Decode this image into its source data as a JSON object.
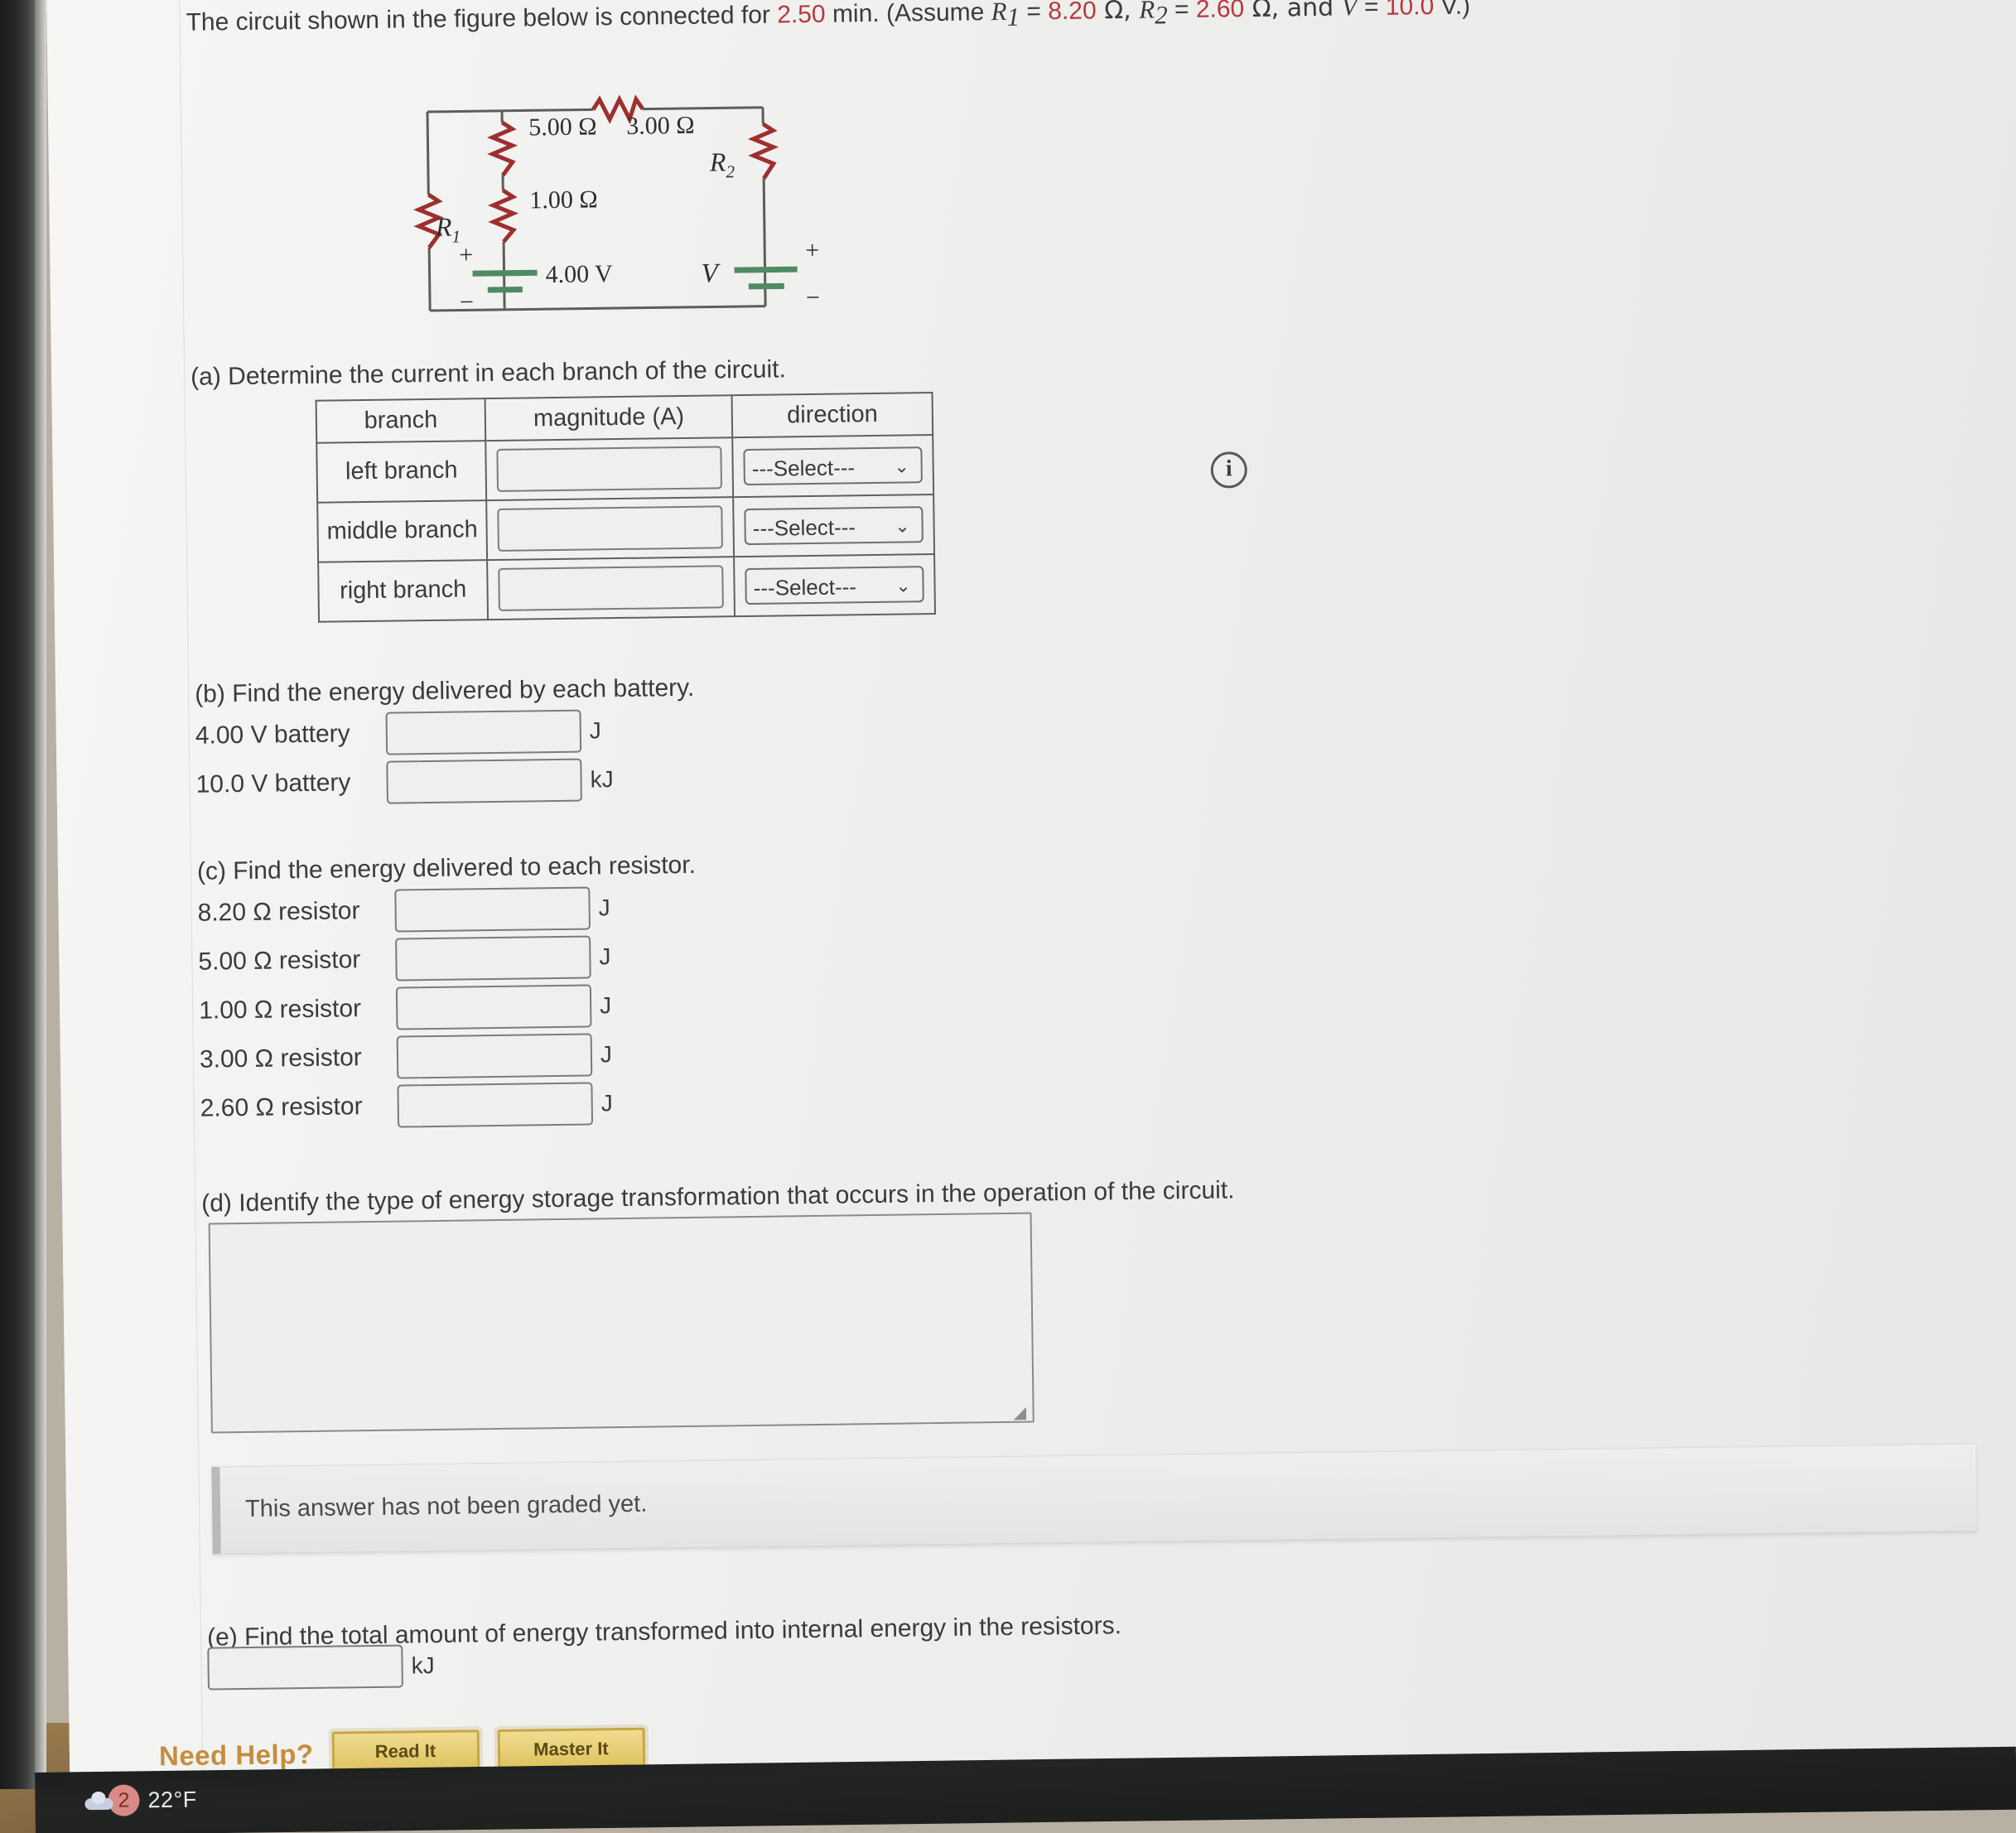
{
  "question": {
    "intro_1": "The circuit shown in the figure below is connected for ",
    "time_value": "2.50",
    "intro_2": " min. (Assume ",
    "r1_symbol": "R",
    "r1_sub": "1",
    "r1_eq": " = ",
    "r1_value": "8.20",
    "r1_unit": " Ω, ",
    "r2_symbol": "R",
    "r2_sub": "2",
    "r2_eq": " = ",
    "r2_value": "2.60",
    "r2_unit": " Ω, and ",
    "v_symbol": "V",
    "v_eq": " = ",
    "v_value": "10.0",
    "v_unit": " V.)"
  },
  "figure": {
    "r_5": "5.00 Ω",
    "r_3": "3.00 Ω",
    "r_1": "1.00 Ω",
    "battery_4v": "4.00 V",
    "label_R1": "R",
    "label_R1_sub": "1",
    "label_R2": "R",
    "label_R2_sub": "2",
    "label_V": "V",
    "plus": "+",
    "minus": "−",
    "info_icon": "i",
    "colors": {
      "resistor": "#9e2f2f",
      "wire": "#5a5e5c",
      "battery": "#4e8a63"
    }
  },
  "parts": {
    "a": {
      "prompt": "(a) Determine the current in each branch of the circuit.",
      "headers": [
        "branch",
        "magnitude (A)",
        "direction"
      ],
      "rows": [
        {
          "branch": "left branch",
          "magnitude": "",
          "direction": "---Select---"
        },
        {
          "branch": "middle branch",
          "magnitude": "",
          "direction": "---Select---"
        },
        {
          "branch": "right branch",
          "magnitude": "",
          "direction": "---Select---"
        }
      ],
      "chevron": "⌄"
    },
    "b": {
      "prompt": "(b) Find the energy delivered by each battery.",
      "rows": [
        {
          "label": "4.00 V battery",
          "value": "",
          "unit": "J"
        },
        {
          "label": "10.0 V battery",
          "value": "",
          "unit": "kJ"
        }
      ]
    },
    "c": {
      "prompt": "(c) Find the energy delivered to each resistor.",
      "rows": [
        {
          "label": "8.20 Ω resistor",
          "value": "",
          "unit": "J"
        },
        {
          "label": "5.00 Ω resistor",
          "value": "",
          "unit": "J"
        },
        {
          "label": "1.00 Ω resistor",
          "value": "",
          "unit": "J"
        },
        {
          "label": "3.00 Ω resistor",
          "value": "",
          "unit": "J"
        },
        {
          "label": "2.60 Ω resistor",
          "value": "",
          "unit": "J"
        }
      ]
    },
    "d": {
      "prompt": "(d) Identify the type of energy storage transformation that occurs in the operation of the circuit.",
      "answer": "",
      "resize_grip": "◢"
    },
    "graded_message": "This answer has not been graded yet.",
    "e": {
      "prompt": "(e) Find the total amount of energy transformed into internal energy in the resistors.",
      "value": "",
      "unit": "kJ"
    }
  },
  "need_help": {
    "label": "Need Help?",
    "read_it": "Read It",
    "master_it": "Master It"
  },
  "taskbar": {
    "weather_icon": "cloud-icon",
    "notification_count": "2",
    "temperature": "22°F"
  }
}
